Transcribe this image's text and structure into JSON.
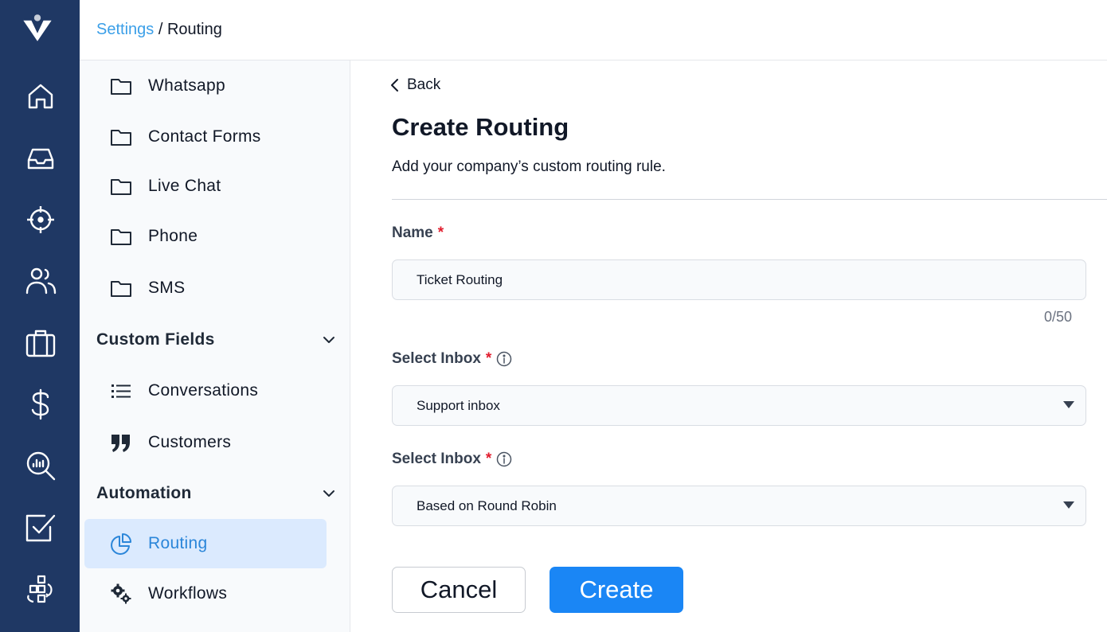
{
  "breadcrumb": {
    "parent": "Settings",
    "separator": " / ",
    "current": "Routing"
  },
  "rail": {
    "items": [
      {
        "icon": "home-icon"
      },
      {
        "icon": "inbox-icon"
      },
      {
        "icon": "target-icon"
      },
      {
        "icon": "users-icon"
      },
      {
        "icon": "briefcase-icon"
      },
      {
        "icon": "dollar-icon"
      },
      {
        "icon": "analytics-search-icon"
      },
      {
        "icon": "checkbox-icon"
      },
      {
        "icon": "flow-icon"
      }
    ]
  },
  "sidebar": {
    "items_top": [
      {
        "label": "Whatsapp",
        "icon": "folder-icon"
      },
      {
        "label": "Contact Forms",
        "icon": "folder-icon"
      },
      {
        "label": "Live Chat",
        "icon": "folder-icon"
      },
      {
        "label": "Phone",
        "icon": "folder-icon"
      },
      {
        "label": "SMS",
        "icon": "folder-icon"
      }
    ],
    "custom_fields": {
      "title": "Custom Fields",
      "items": [
        {
          "label": "Conversations",
          "icon": "list-icon"
        },
        {
          "label": "Customers",
          "icon": "quote-icon"
        }
      ]
    },
    "automation": {
      "title": "Automation",
      "items": [
        {
          "label": "Routing",
          "icon": "pie-chart-icon",
          "active": true
        },
        {
          "label": "Workflows",
          "icon": "gears-icon"
        }
      ]
    }
  },
  "main": {
    "back_label": "Back",
    "title": "Create Routing",
    "subtitle": "Add your company’s custom routing rule.",
    "name_field": {
      "label": "Name",
      "required": "*",
      "value": "Ticket Routing",
      "counter": "0/50"
    },
    "inbox_field": {
      "label": "Select Inbox",
      "required": "*",
      "value": "Support inbox"
    },
    "method_field": {
      "label": "Select Inbox",
      "required": "*",
      "value": "Based on Round Robin"
    },
    "cancel_label": "Cancel",
    "create_label": "Create"
  },
  "colors": {
    "rail_bg": "#1f3864",
    "accent": "#1a86f5",
    "link": "#3b9fe8",
    "active_bg": "#dbeafe",
    "required": "#e11d2e"
  }
}
